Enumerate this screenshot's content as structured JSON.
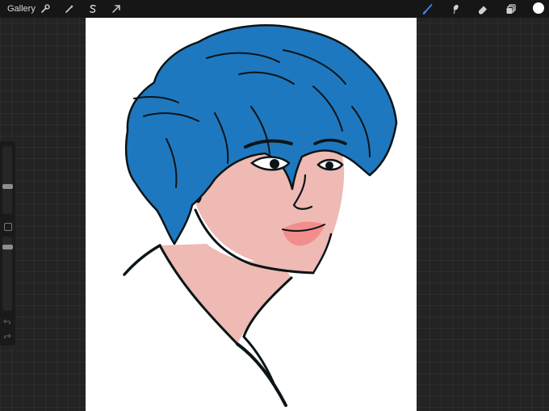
{
  "toolbar": {
    "gallery_label": "Gallery",
    "left_tools": [
      {
        "name": "wrench-icon"
      },
      {
        "name": "magic-wand-icon"
      },
      {
        "name": "selection-s-icon"
      },
      {
        "name": "transform-arrow-icon"
      }
    ],
    "right_tools": [
      {
        "name": "brush-icon",
        "active": true
      },
      {
        "name": "smudge-icon",
        "active": false
      },
      {
        "name": "eraser-icon",
        "active": false
      },
      {
        "name": "layers-icon",
        "active": false
      }
    ],
    "current_color": "#ffffff"
  },
  "colors": {
    "active_tool": "#2f8cff",
    "hair": "#1e78bf",
    "skin": "#eebab3",
    "lips": "#f28d8d",
    "line": "#0b1417",
    "canvas": "#ffffff"
  },
  "sidebar": {
    "brush_size_icon": "brush-size-slider",
    "opacity_icon": "opacity-slider",
    "modify_icon": "modify-square-icon",
    "undo_icon": "undo-arrow-icon",
    "redo_icon": "redo-arrow-icon"
  }
}
